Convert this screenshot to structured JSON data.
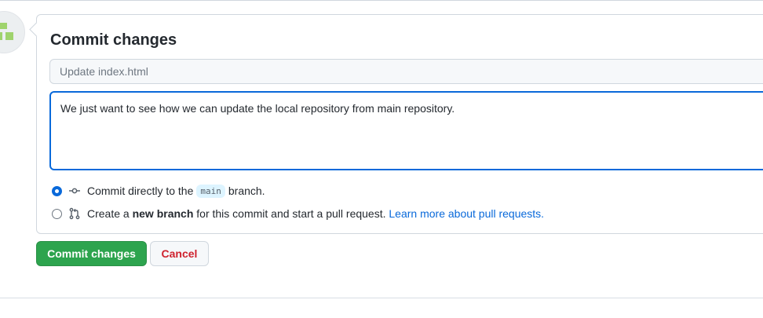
{
  "commit_form": {
    "title": "Commit changes",
    "summary": {
      "placeholder": "Update index.html",
      "value": ""
    },
    "description": {
      "value": "We just want to see how we can update the local repository from main repository."
    },
    "options": {
      "direct": {
        "selected": true,
        "text_before": "Commit directly to the",
        "branch": "main",
        "text_after": "branch."
      },
      "new_branch": {
        "selected": false,
        "text_before": "Create a",
        "bold": "new branch",
        "text_after": "for this commit and start a pull request.",
        "link": "Learn more about pull requests."
      }
    },
    "buttons": {
      "commit": "Commit changes",
      "cancel": "Cancel"
    }
  },
  "icons": {
    "avatar": "identicon-avatar",
    "commit_option": "git-commit-icon",
    "branch_option": "git-pull-request-icon"
  },
  "colors": {
    "accent": "#0969da",
    "primary_button": "#2da44e",
    "danger_text": "#cf222e",
    "identicon": "#9fd36d"
  }
}
